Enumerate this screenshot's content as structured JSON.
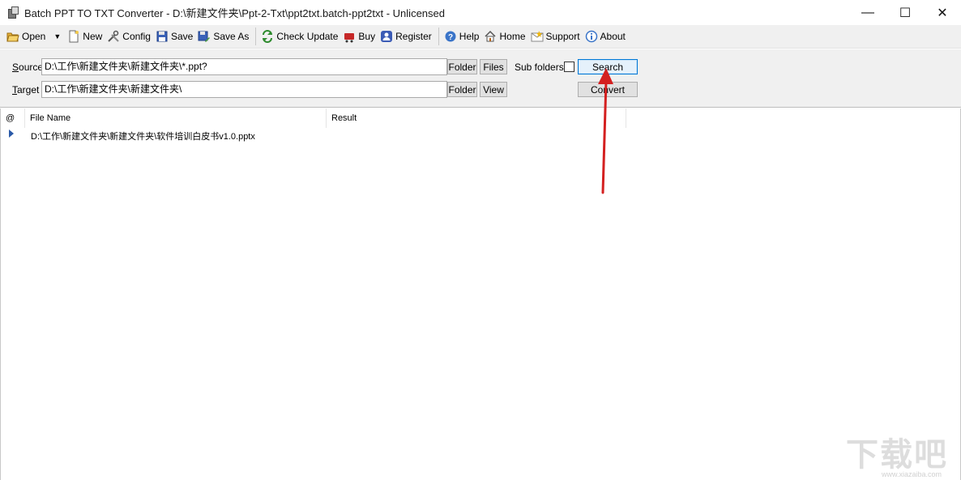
{
  "window": {
    "title": "Batch PPT TO TXT Converter - D:\\新建文件夹\\Ppt-2-Txt\\ppt2txt.batch-ppt2txt - Unlicensed",
    "minimize": "—",
    "maximize": "☐",
    "close": "✕"
  },
  "toolbar": {
    "open": "Open",
    "new": "New",
    "config": "Config",
    "save": "Save",
    "save_as": "Save As",
    "check_update": "Check Update",
    "buy": "Buy",
    "register": "Register",
    "help": "Help",
    "home": "Home",
    "support": "Support",
    "about": "About"
  },
  "source": {
    "label_first": "S",
    "label_rest": "ource",
    "value": "D:\\工作\\新建文件夹\\新建文件夹\\*.ppt?",
    "folder_btn": "Folder",
    "files_btn": "Files",
    "subfolders_label": "Sub folders",
    "subfolders_checked": false,
    "search_btn": "Search"
  },
  "target": {
    "label_first": "T",
    "label_rest": "arget",
    "value": "D:\\工作\\新建文件夹\\新建文件夹\\",
    "folder_btn": "Folder",
    "view_btn": "View",
    "convert_btn": "Convert"
  },
  "list": {
    "columns": [
      "@",
      "File Name",
      "Result"
    ],
    "rows": [
      {
        "file": "D:\\工作\\新建文件夹\\新建文件夹\\软件培训白皮书v1.0.pptx",
        "result": ""
      }
    ]
  },
  "annotation": {
    "arrow_color": "#d42020"
  },
  "watermark": {
    "text": "下载吧",
    "site": "www.xiazaiba.com"
  }
}
